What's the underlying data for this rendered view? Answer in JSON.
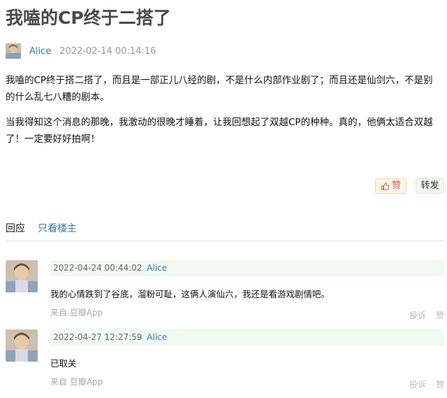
{
  "post": {
    "title": "我嗑的CP终于二搭了",
    "author": "Alice",
    "datetime": "2022-02-14 00:14:16",
    "paragraphs": [
      "我嗑的CP终于搭二搭了，而且是一部正儿八经的剧，不是什么内部作业剧了；而且还是仙剑六，不是别的什么乱七八糟的剧本。",
      "当我得知这个消息的那晚，我激动的很晚才睡着，让我回想起了双越CP的种种。真的，他俩太适合双越了！一定要好好拍啊！"
    ]
  },
  "actions": {
    "like_label": "赞",
    "share_label": "转发",
    "like_icon": "thumbs-up-icon",
    "like_color": "#ca6445",
    "like_bg": "#fff4ea",
    "share_bg": "#f2f8f2"
  },
  "tabs": {
    "reply": "回应",
    "owner_only": "只看楼主"
  },
  "comments": [
    {
      "datetime": "2022-04-24 00:44:02",
      "user": "Alice",
      "text": "我的心情跌到了谷底，溜粉可耻，这俩人演仙六，我还是看游戏剧情吧。",
      "source": "来自 豆瓣App",
      "report": "投诉",
      "like": "赞"
    },
    {
      "datetime": "2022-04-27 12:27:59",
      "user": "Alice",
      "text": "已取关",
      "source": "来自 豆瓣App",
      "report": "投诉",
      "like": "赞"
    }
  ],
  "colors": {
    "link": "#3377aa",
    "comment_header_bg": "#f0faf0"
  }
}
